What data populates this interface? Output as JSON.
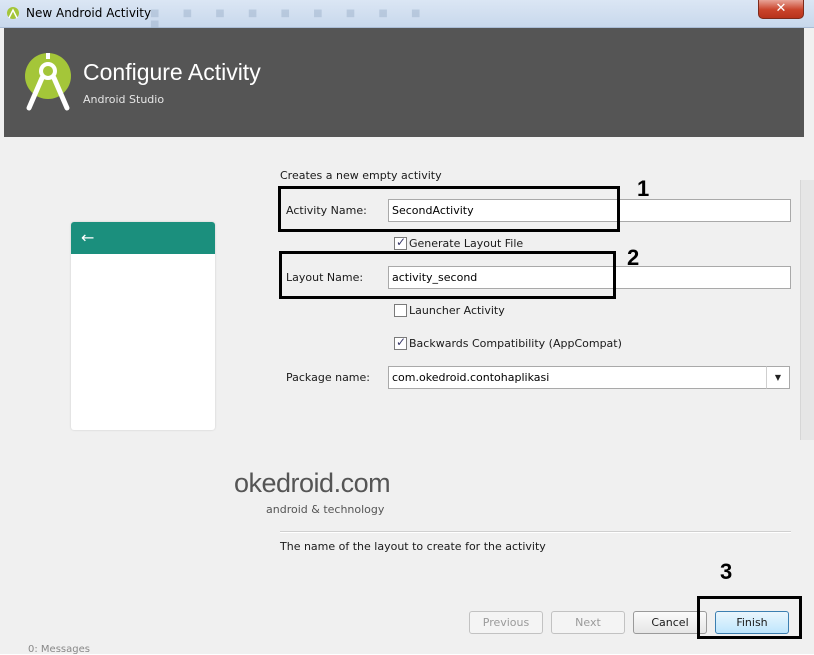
{
  "window": {
    "title": "New Android Activity",
    "close_label": "✕"
  },
  "header": {
    "title": "Configure Activity",
    "subtitle": "Android Studio"
  },
  "preview": {
    "back_arrow": "←",
    "appbar_color": "#1b8f7d"
  },
  "form": {
    "intro": "Creates a new empty activity",
    "activity_name_label": "Activity Name:",
    "activity_name_value": "SecondActivity",
    "generate_layout_label": "Generate Layout File",
    "generate_layout_checked": true,
    "layout_name_label": "Layout Name:",
    "layout_name_value": "activity_second",
    "launcher_label": "Launcher Activity",
    "launcher_checked": false,
    "backwards_label": "Backwards Compatibility (AppCompat)",
    "backwards_checked": true,
    "package_label": "Package name:",
    "package_value": "com.okedroid.contohaplikasi"
  },
  "annotations": {
    "n1": "1",
    "n2": "2",
    "n3": "3"
  },
  "watermark": {
    "main": "okedroid.com",
    "sub": "android & technology"
  },
  "description": "The name of the layout to create for the activity",
  "buttons": {
    "previous": "Previous",
    "next": "Next",
    "cancel": "Cancel",
    "finish": "Finish"
  },
  "background_text": "0: Messages",
  "colors": {
    "header_bg": "#555555",
    "android_green": "#a4c639"
  }
}
